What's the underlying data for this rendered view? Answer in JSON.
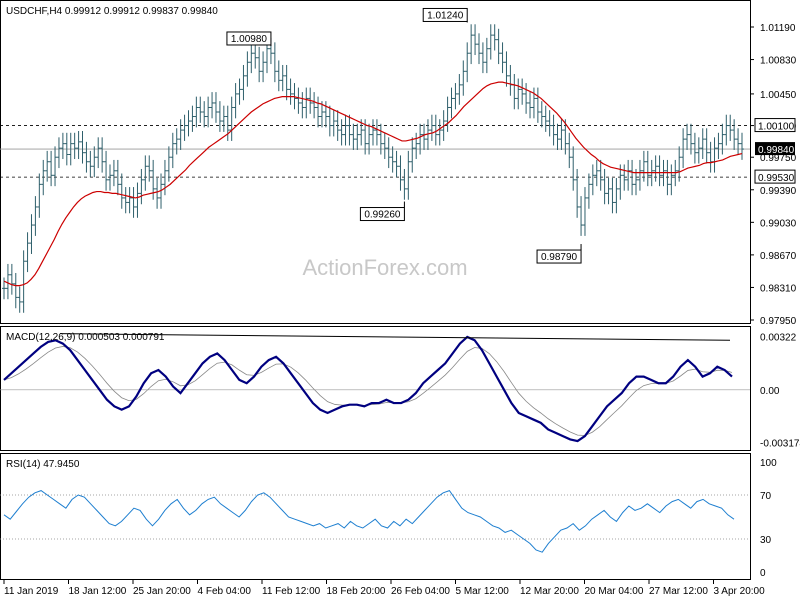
{
  "chart_data": [
    {
      "type": "ohlc",
      "panel": "price",
      "title": "USDCHF,H4  0.99912 0.99912 0.99837 0.99840",
      "watermark": "ActionForex.com",
      "ylim": [
        0.9795,
        1.014
      ],
      "yticks": [
        "1.01190",
        "1.00830",
        "1.00450",
        "1.00100",
        "0.99750",
        "0.99390",
        "0.99030",
        "0.98670",
        "0.98310",
        "0.97950"
      ],
      "ytick_values": [
        1.0119,
        1.0083,
        1.0045,
        1.001,
        0.9975,
        0.9939,
        0.9903,
        0.9867,
        0.9831,
        0.9795
      ],
      "levels": [
        {
          "label": "1.00100",
          "value": 1.001,
          "style": "dashed"
        },
        {
          "label": "0.99530",
          "value": 0.9953,
          "style": "dashed"
        }
      ],
      "current_price": {
        "label": "0.99840",
        "value": 0.9984
      },
      "annotations": [
        {
          "label": "1.00980",
          "value": 1.0098,
          "x_index": 68
        },
        {
          "label": "1.01240",
          "value": 1.0124,
          "x_index": 118
        },
        {
          "label": "0.99260",
          "value": 0.9926,
          "x_index": 102
        },
        {
          "label": "0.98790",
          "value": 0.9879,
          "x_index": 147
        }
      ],
      "moving_average_color": "#cc0000",
      "bar_color": "#2e5f6b",
      "series_close": [
        0.983,
        0.9845,
        0.9835,
        0.982,
        0.9815,
        0.986,
        0.988,
        0.99,
        0.992,
        0.9945,
        0.996,
        0.997,
        0.9955,
        0.9975,
        0.9985,
        0.999,
        0.9978,
        0.999,
        0.9985,
        0.9992,
        0.998,
        0.997,
        0.9965,
        0.9975,
        0.9985,
        0.997,
        0.995,
        0.9955,
        0.996,
        0.9945,
        0.993,
        0.9925,
        0.993,
        0.992,
        0.9935,
        0.995,
        0.9965,
        0.996,
        0.994,
        0.993,
        0.9945,
        0.996,
        0.9975,
        0.999,
        0.9995,
        1.0005,
        1.001,
        1.0015,
        1.002,
        1.003,
        1.0025,
        1.002,
        1.003,
        1.0035,
        1.0025,
        1.0015,
        1.002,
        1.0005,
        1.003,
        1.0045,
        1.005,
        1.0065,
        1.008,
        1.009,
        1.0085,
        1.007,
        1.008,
        1.0095,
        1.009,
        1.007,
        1.006,
        1.0065,
        1.005,
        1.0045,
        1.004,
        1.0035,
        1.003,
        1.004,
        1.0035,
        1.003,
        1.002,
        1.0025,
        1.002,
        1.001,
        1.0015,
        1.0005,
        1.0,
        1.001,
        1.0,
        0.9995,
        1.0,
        1.0005,
        0.999,
        1.0,
        1.0005,
        1.0,
        0.999,
        0.9985,
        0.9975,
        0.997,
        0.9965,
        0.995,
        0.994,
        0.997,
        0.9985,
        0.999,
        1.0,
        0.9995,
        1.0005,
        1.001,
        1.0,
        1.0005,
        1.0015,
        1.003,
        1.004,
        1.0045,
        1.0055,
        1.007,
        1.009,
        1.011,
        1.01,
        1.009,
        1.008,
        1.0095,
        1.011,
        1.0105,
        1.009,
        1.008,
        1.0065,
        1.0055,
        1.004,
        1.005,
        1.0045,
        1.0035,
        1.003,
        1.004,
        1.0025,
        1.002,
        1.0015,
        1.001,
        1.0,
        0.9995,
        1.0005,
        0.999,
        0.9975,
        0.995,
        0.992,
        0.99,
        0.993,
        0.9945,
        0.9955,
        0.996,
        0.995,
        0.9935,
        0.994,
        0.9925,
        0.994,
        0.9955,
        0.995,
        0.996,
        0.9945,
        0.995,
        0.996,
        0.997,
        0.9955,
        0.996,
        0.9965,
        0.9955,
        0.996,
        0.9945,
        0.9955,
        0.996,
        0.9975,
        0.9995,
        1.0,
        0.999,
        0.998,
        0.9985,
        0.9995,
        0.998,
        0.997,
        0.9985,
        0.999,
        1.0,
        1.001,
        1.0005,
        0.9995,
        0.999,
        0.9984
      ],
      "moving_average": [
        0.9838,
        0.9836,
        0.9834,
        0.9833,
        0.9833,
        0.9834,
        0.9836,
        0.984,
        0.9845,
        0.9852,
        0.986,
        0.9868,
        0.9876,
        0.9884,
        0.9893,
        0.9901,
        0.9908,
        0.9914,
        0.992,
        0.9925,
        0.9929,
        0.9932,
        0.9934,
        0.9936,
        0.9937,
        0.9937,
        0.9936,
        0.9936,
        0.9935,
        0.9935,
        0.9934,
        0.9933,
        0.9932,
        0.9931,
        0.993,
        0.9931,
        0.9933,
        0.9934,
        0.9935,
        0.9936,
        0.9937,
        0.9939,
        0.9942,
        0.9945,
        0.9949,
        0.9953,
        0.9957,
        0.9961,
        0.9966,
        0.997,
        0.9974,
        0.9978,
        0.9982,
        0.9986,
        0.9989,
        0.9992,
        0.9995,
        0.9998,
        1.0001,
        1.0005,
        1.0009,
        1.0013,
        1.0017,
        1.0021,
        1.0025,
        1.0028,
        1.0031,
        1.0034,
        1.0036,
        1.0038,
        1.004,
        1.0041,
        1.0042,
        1.0042,
        1.0042,
        1.0042,
        1.0041,
        1.004,
        1.0039,
        1.0038,
        1.0037,
        1.0035,
        1.0034,
        1.0032,
        1.003,
        1.0028,
        1.0026,
        1.0024,
        1.0022,
        1.002,
        1.0018,
        1.0016,
        1.0014,
        1.0012,
        1.001,
        1.0009,
        1.0007,
        1.0005,
        1.0003,
        1.0001,
        0.9999,
        0.9997,
        0.9995,
        0.9993,
        0.9993,
        0.9994,
        0.9995,
        0.9996,
        0.9998,
        1.0,
        1.0001,
        1.0002,
        1.0004,
        1.0007,
        1.001,
        1.0013,
        1.0017,
        1.0021,
        1.0026,
        1.0031,
        1.0035,
        1.0039,
        1.0043,
        1.0047,
        1.0051,
        1.0054,
        1.0056,
        1.0057,
        1.0058,
        1.0058,
        1.0057,
        1.0056,
        1.0055,
        1.0054,
        1.0052,
        1.005,
        1.0048,
        1.0046,
        1.0043,
        1.004,
        1.0036,
        1.0032,
        1.0028,
        1.0024,
        1.0019,
        1.0014,
        1.0008,
        1.0002,
        0.9996,
        0.9991,
        0.9986,
        0.9982,
        0.9978,
        0.9975,
        0.9971,
        0.9968,
        0.9966,
        0.9964,
        0.9963,
        0.9962,
        0.9961,
        0.996,
        0.9959,
        0.9958,
        0.9958,
        0.9958,
        0.9958,
        0.9958,
        0.9958,
        0.9958,
        0.9958,
        0.9958,
        0.9958,
        0.9958,
        0.9958,
        0.9959,
        0.9961,
        0.9963,
        0.9964,
        0.9965,
        0.9966,
        0.9968,
        0.9969,
        0.9969,
        0.997,
        0.9971,
        0.9972,
        0.9974,
        0.9976,
        0.9977,
        0.9978,
        0.9979
      ]
    },
    {
      "type": "line",
      "panel": "macd",
      "title": "MACD(12,26,9) 0.000503 0.000791",
      "ylim": [
        -0.0034,
        0.0035
      ],
      "yticks": [
        "0.00322",
        "0.00",
        "-0.003174"
      ],
      "ytick_values": [
        0.00322,
        0.0,
        -0.003174
      ],
      "series": [
        {
          "name": "",
          "color": "#000080",
          "values": [
            0.0006,
            0.001,
            0.0014,
            0.0018,
            0.0022,
            0.0026,
            0.0029,
            0.003,
            0.0028,
            0.0024,
            0.0018,
            0.0012,
            0.0006,
            0.0,
            -0.0006,
            -0.001,
            -0.0012,
            -0.001,
            -0.0004,
            0.0004,
            0.001,
            0.0012,
            0.0008,
            0.0002,
            -0.0002,
            0.0004,
            0.001,
            0.0016,
            0.002,
            0.0022,
            0.0018,
            0.0012,
            0.0006,
            0.0004,
            0.0008,
            0.0014,
            0.0018,
            0.002,
            0.0016,
            0.001,
            0.0004,
            -0.0002,
            -0.0008,
            -0.0012,
            -0.0014,
            -0.0012,
            -0.001,
            -0.0009,
            -0.0009,
            -0.001,
            -0.0008,
            -0.0008,
            -0.0006,
            -0.0008,
            -0.0008,
            -0.0006,
            -0.0002,
            0.0004,
            0.0008,
            0.0012,
            0.0016,
            0.0022,
            0.0028,
            0.0032,
            0.003,
            0.0024,
            0.0016,
            0.0008,
            0.0,
            -0.0008,
            -0.0014,
            -0.0016,
            -0.0018,
            -0.002,
            -0.0024,
            -0.0026,
            -0.0028,
            -0.003,
            -0.0031,
            -0.0028,
            -0.0022,
            -0.0016,
            -0.001,
            -0.0006,
            -0.0002,
            0.0004,
            0.0008,
            0.0008,
            0.0006,
            0.0004,
            0.0004,
            0.0008,
            0.0014,
            0.0018,
            0.0014,
            0.0008,
            0.001,
            0.0014,
            0.0012,
            0.0008
          ]
        }
      ]
    },
    {
      "type": "line",
      "panel": "rsi",
      "title": "RSI(14) 47.9450",
      "ylim": [
        0,
        100
      ],
      "yticks": [
        "100",
        "70",
        "30",
        "0"
      ],
      "ytick_values": [
        100,
        70,
        30,
        0
      ],
      "levels": [
        {
          "value": 70,
          "style": "dotted"
        },
        {
          "value": 30,
          "style": "dotted"
        }
      ],
      "series": [
        {
          "name": "",
          "color": "#1e7fd0",
          "values": [
            52,
            48,
            55,
            62,
            68,
            72,
            74,
            70,
            66,
            62,
            58,
            66,
            70,
            68,
            62,
            56,
            50,
            44,
            42,
            46,
            52,
            58,
            56,
            48,
            42,
            48,
            56,
            62,
            66,
            58,
            52,
            56,
            62,
            66,
            68,
            62,
            58,
            54,
            50,
            56,
            64,
            70,
            72,
            68,
            62,
            56,
            50,
            48,
            46,
            44,
            42,
            44,
            40,
            42,
            44,
            40,
            46,
            42,
            40,
            44,
            48,
            42,
            40,
            46,
            42,
            48,
            44,
            50,
            56,
            62,
            68,
            72,
            74,
            66,
            58,
            54,
            52,
            50,
            46,
            42,
            40,
            36,
            38,
            34,
            30,
            26,
            20,
            18,
            26,
            32,
            38,
            40,
            44,
            38,
            42,
            48,
            52,
            56,
            50,
            46,
            54,
            60,
            56,
            58,
            62,
            58,
            54,
            60,
            64,
            66,
            62,
            58,
            64,
            66,
            62,
            60,
            58,
            52,
            48
          ]
        }
      ]
    }
  ],
  "x_axis": {
    "labels": [
      "11 Jan 2019",
      "18 Jan 12:00",
      "25 Jan 20:00",
      "4 Feb 04:00",
      "11 Feb 12:00",
      "18 Feb 20:00",
      "26 Feb 04:00",
      "5 Mar 12:00",
      "12 Mar 20:00",
      "20 Mar 04:00",
      "27 Mar 12:00",
      "3 Apr 20:00"
    ]
  }
}
